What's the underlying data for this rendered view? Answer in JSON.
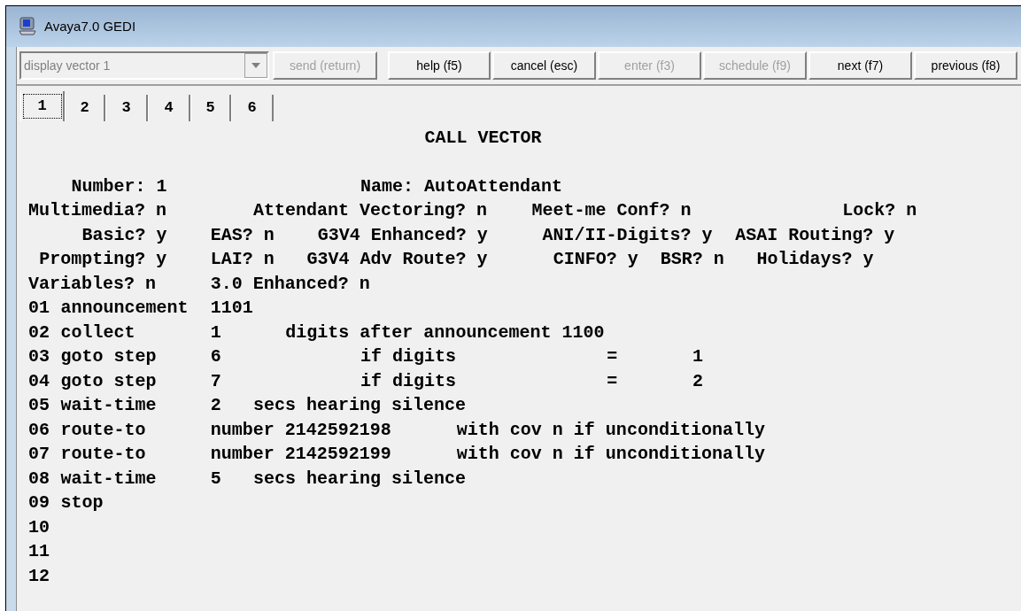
{
  "window": {
    "title": "Avaya7.0 GEDI"
  },
  "toolbar": {
    "command_field": {
      "value": "display vector 1",
      "disabled": true
    },
    "buttons": [
      {
        "label": "send (return)",
        "disabled": true
      },
      {
        "label": "help (f5)",
        "disabled": false
      },
      {
        "label": "cancel (esc)",
        "disabled": false
      },
      {
        "label": "enter (f3)",
        "disabled": true
      },
      {
        "label": "schedule (f9)",
        "disabled": true
      },
      {
        "label": "next (f7)",
        "disabled": false
      },
      {
        "label": "previous (f8)",
        "disabled": false
      }
    ]
  },
  "tabs": [
    {
      "label": "1",
      "selected": true
    },
    {
      "label": "2",
      "selected": false
    },
    {
      "label": "3",
      "selected": false
    },
    {
      "label": "4",
      "selected": false
    },
    {
      "label": "5",
      "selected": false
    },
    {
      "label": "6",
      "selected": false
    }
  ],
  "screen": {
    "heading": "CALL VECTOR",
    "fields": [
      [
        "Number: 1",
        "Name: AutoAttendant"
      ],
      [
        "Multimedia? n",
        "Attendant Vectoring? n",
        "Meet-me Conf? n",
        "Lock? n"
      ],
      [
        "Basic? y",
        "EAS? n",
        "G3V4 Enhanced? y",
        "ANI/II-Digits? y",
        "ASAI Routing? y"
      ],
      [
        "Prompting? y",
        "LAI? n",
        "G3V4 Adv Route? y",
        "CINFO? y",
        "BSR? n",
        "Holidays? y"
      ],
      [
        "Variables? n",
        "3.0 Enhanced? n"
      ]
    ],
    "steps": [
      {
        "number": "01",
        "command": "announcement",
        "args": [
          "1101"
        ]
      },
      {
        "number": "02",
        "command": "collect",
        "args": [
          "1",
          "digits after announcement 1100"
        ]
      },
      {
        "number": "03",
        "command": "goto step",
        "args": [
          "6",
          "if digits",
          "=",
          "1"
        ]
      },
      {
        "number": "04",
        "command": "goto step",
        "args": [
          "7",
          "if digits",
          "=",
          "2"
        ]
      },
      {
        "number": "05",
        "command": "wait-time",
        "args": [
          "2",
          "secs hearing silence"
        ]
      },
      {
        "number": "06",
        "command": "route-to",
        "args": [
          "number 2142592198",
          "with cov n if unconditionally"
        ]
      },
      {
        "number": "07",
        "command": "route-to",
        "args": [
          "number 2142592199",
          "with cov n if unconditionally"
        ]
      },
      {
        "number": "08",
        "command": "wait-time",
        "args": [
          "5",
          "secs hearing silence"
        ]
      },
      {
        "number": "09",
        "command": "stop"
      },
      {
        "number": "10"
      },
      {
        "number": "11"
      },
      {
        "number": "12"
      }
    ]
  }
}
